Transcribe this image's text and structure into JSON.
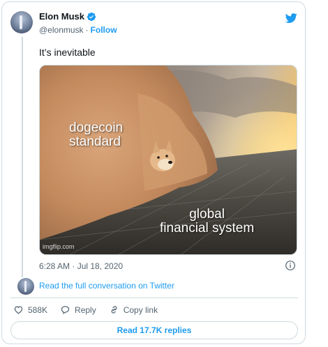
{
  "colors": {
    "accent": "#1d9bf0",
    "muted": "#536471",
    "border": "#cfd9de"
  },
  "author": {
    "name": "Elon Musk",
    "handle": "@elonmusk",
    "separator": "·",
    "follow_label": "Follow",
    "verified": true
  },
  "tweet": {
    "text": "It’s inevitable",
    "media": {
      "top_caption_line1": "dogecoin",
      "top_caption_line2": "standard",
      "bottom_caption_line1": "global",
      "bottom_caption_line2": "financial system",
      "watermark": "imgflip.com"
    },
    "timestamp": "6:28 AM · Jul 18, 2020"
  },
  "conversation_link": "Read the full conversation on Twitter",
  "actions": {
    "likes": "588K",
    "reply_label": "Reply",
    "copy_link_label": "Copy link"
  },
  "read_replies_label": "Read 17.7K replies",
  "icons": [
    "twitter-bird-icon",
    "verified-badge-icon",
    "info-icon",
    "heart-icon",
    "reply-icon",
    "link-icon"
  ]
}
